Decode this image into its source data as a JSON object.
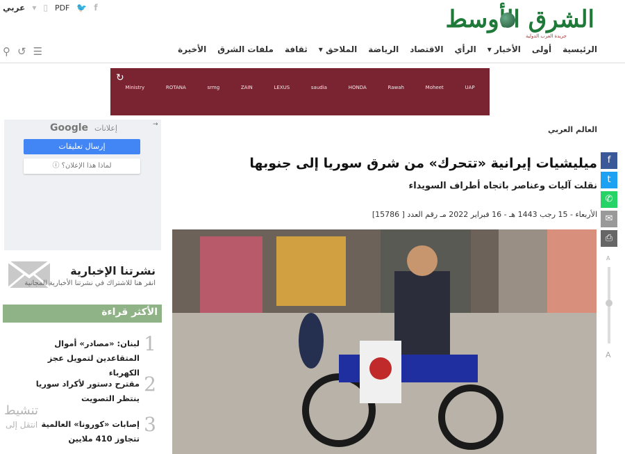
{
  "topbar": {
    "language": "عربي",
    "pdf_label": "PDF"
  },
  "logo": {
    "name": "الشرق الأوسط",
    "tagline": "جريدة العرب الدولية"
  },
  "nav": {
    "items": [
      "الرئيسية",
      "أولى",
      "الأخبار",
      "الرأي",
      "الاقتصاد",
      "الرياضة",
      "الملاحق",
      "ثقافة",
      "ملفات الشرق",
      "الأخيرة"
    ]
  },
  "banner": {
    "logos": [
      "Ministry",
      "ROTANA",
      "srmg",
      "ZAIN",
      "LEXUS",
      "saudia",
      "HONDA",
      "Rawah",
      "Moheet",
      "UAP"
    ]
  },
  "google_ad": {
    "ads_label": "إعلانات",
    "brand": "Google",
    "send_label": "إرسال تعليقات",
    "why_label": "لماذا هذا الإعلان؟"
  },
  "newsletter": {
    "title": "نشرتنا الإخبارية",
    "subtitle": "انقر هنا للاشتراك في نشرتنا الأخبارية المجانية"
  },
  "most_read": {
    "heading": "الأكثر قراءة",
    "items": [
      {
        "rank": "1",
        "title": "لبنان: «مصادر» أموال المتقاعدين لتمويل عجز الكهرباء"
      },
      {
        "rank": "2",
        "title": "مقترح دستور لأكراد سوريا ينتظر التصويت"
      },
      {
        "rank": "3",
        "title": "إصابات «كورونا» العالمية تتجاوز 410 ملايين"
      }
    ]
  },
  "watermark": {
    "line1": "تنشيط",
    "line2": "انتقل إلى"
  },
  "article": {
    "section": "العالم العربي",
    "headline": "ميليشيات إيرانية «تتحرك» من شرق سوريا إلى جنوبها",
    "subheadline": "نقلت آليات وعناصر باتجاه أطراف السويداء",
    "dateline": "الأربعاء - 15 رجب 1443 هـ - 16 فبراير 2022 مـ رقم العدد [ 15786]"
  },
  "share": {
    "colors": [
      "#3b5998",
      "#1da1f2",
      "#25d366",
      "#999999",
      "#666666"
    ]
  },
  "colors": {
    "brand_green": "#1f7a3a",
    "banner": "#7b2431",
    "most_read_bar": "#8fb386",
    "google_blue": "#4285f4"
  }
}
